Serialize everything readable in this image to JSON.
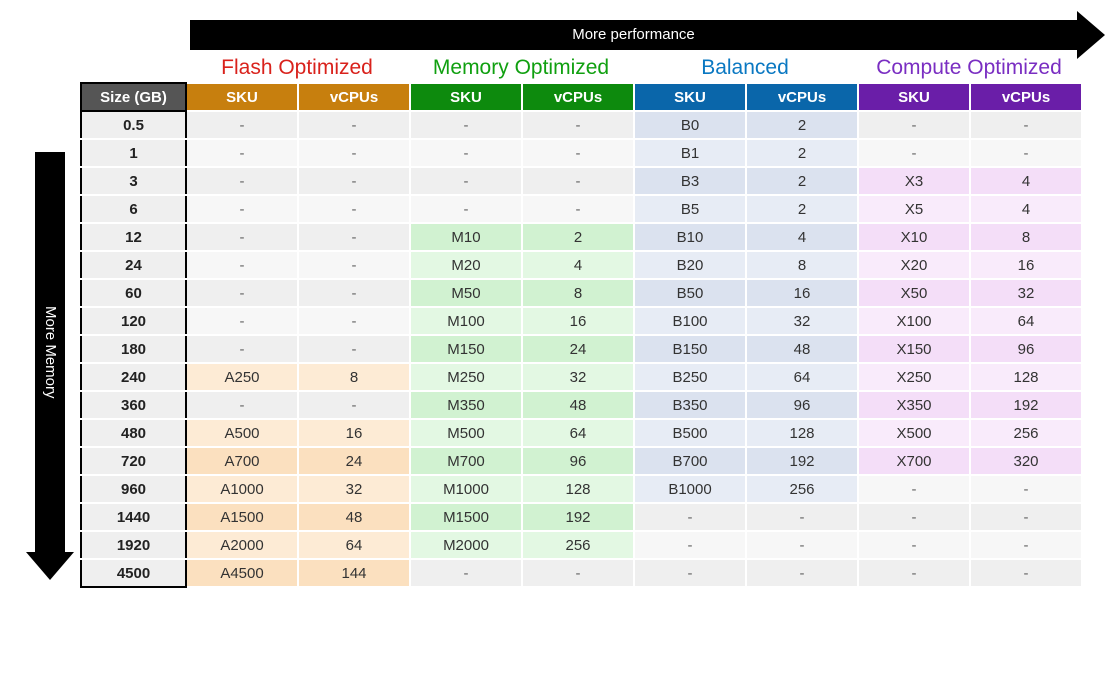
{
  "labels": {
    "more_performance": "More performance",
    "more_memory": "More Memory"
  },
  "categories": {
    "flash": {
      "title": "Flash Optimized",
      "sku": "SKU",
      "vcpu": "vCPUs",
      "color": "#d9221c"
    },
    "memory": {
      "title": "Memory Optimized",
      "sku": "SKU",
      "vcpu": "vCPUs",
      "color": "#10a010"
    },
    "balanced": {
      "title": "Balanced",
      "sku": "SKU",
      "vcpu": "vCPUs",
      "color": "#0a78c2"
    },
    "compute": {
      "title": "Compute Optimized",
      "sku": "SKU",
      "vcpu": "vCPUs",
      "color": "#7a2ec2"
    }
  },
  "size_header": "Size (GB)",
  "chart_data": {
    "type": "table",
    "rows": [
      {
        "size": "0.5",
        "flash": {
          "sku": "-",
          "vcpu": "-"
        },
        "memory": {
          "sku": "-",
          "vcpu": "-"
        },
        "balanced": {
          "sku": "B0",
          "vcpu": "2"
        },
        "compute": {
          "sku": "-",
          "vcpu": "-"
        }
      },
      {
        "size": "1",
        "flash": {
          "sku": "-",
          "vcpu": "-"
        },
        "memory": {
          "sku": "-",
          "vcpu": "-"
        },
        "balanced": {
          "sku": "B1",
          "vcpu": "2"
        },
        "compute": {
          "sku": "-",
          "vcpu": "-"
        }
      },
      {
        "size": "3",
        "flash": {
          "sku": "-",
          "vcpu": "-"
        },
        "memory": {
          "sku": "-",
          "vcpu": "-"
        },
        "balanced": {
          "sku": "B3",
          "vcpu": "2"
        },
        "compute": {
          "sku": "X3",
          "vcpu": "4"
        }
      },
      {
        "size": "6",
        "flash": {
          "sku": "-",
          "vcpu": "-"
        },
        "memory": {
          "sku": "-",
          "vcpu": "-"
        },
        "balanced": {
          "sku": "B5",
          "vcpu": "2"
        },
        "compute": {
          "sku": "X5",
          "vcpu": "4"
        }
      },
      {
        "size": "12",
        "flash": {
          "sku": "-",
          "vcpu": "-"
        },
        "memory": {
          "sku": "M10",
          "vcpu": "2"
        },
        "balanced": {
          "sku": "B10",
          "vcpu": "4"
        },
        "compute": {
          "sku": "X10",
          "vcpu": "8"
        }
      },
      {
        "size": "24",
        "flash": {
          "sku": "-",
          "vcpu": "-"
        },
        "memory": {
          "sku": "M20",
          "vcpu": "4"
        },
        "balanced": {
          "sku": "B20",
          "vcpu": "8"
        },
        "compute": {
          "sku": "X20",
          "vcpu": "16"
        }
      },
      {
        "size": "60",
        "flash": {
          "sku": "-",
          "vcpu": "-"
        },
        "memory": {
          "sku": "M50",
          "vcpu": "8"
        },
        "balanced": {
          "sku": "B50",
          "vcpu": "16"
        },
        "compute": {
          "sku": "X50",
          "vcpu": "32"
        }
      },
      {
        "size": "120",
        "flash": {
          "sku": "-",
          "vcpu": "-"
        },
        "memory": {
          "sku": "M100",
          "vcpu": "16"
        },
        "balanced": {
          "sku": "B100",
          "vcpu": "32"
        },
        "compute": {
          "sku": "X100",
          "vcpu": "64"
        }
      },
      {
        "size": "180",
        "flash": {
          "sku": "-",
          "vcpu": "-"
        },
        "memory": {
          "sku": "M150",
          "vcpu": "24"
        },
        "balanced": {
          "sku": "B150",
          "vcpu": "48"
        },
        "compute": {
          "sku": "X150",
          "vcpu": "96"
        }
      },
      {
        "size": "240",
        "flash": {
          "sku": "A250",
          "vcpu": "8"
        },
        "memory": {
          "sku": "M250",
          "vcpu": "32"
        },
        "balanced": {
          "sku": "B250",
          "vcpu": "64"
        },
        "compute": {
          "sku": "X250",
          "vcpu": "128"
        }
      },
      {
        "size": "360",
        "flash": {
          "sku": "-",
          "vcpu": "-"
        },
        "memory": {
          "sku": "M350",
          "vcpu": "48"
        },
        "balanced": {
          "sku": "B350",
          "vcpu": "96"
        },
        "compute": {
          "sku": "X350",
          "vcpu": "192"
        }
      },
      {
        "size": "480",
        "flash": {
          "sku": "A500",
          "vcpu": "16"
        },
        "memory": {
          "sku": "M500",
          "vcpu": "64"
        },
        "balanced": {
          "sku": "B500",
          "vcpu": "128"
        },
        "compute": {
          "sku": "X500",
          "vcpu": "256"
        }
      },
      {
        "size": "720",
        "flash": {
          "sku": "A700",
          "vcpu": "24"
        },
        "memory": {
          "sku": "M700",
          "vcpu": "96"
        },
        "balanced": {
          "sku": "B700",
          "vcpu": "192"
        },
        "compute": {
          "sku": "X700",
          "vcpu": "320"
        }
      },
      {
        "size": "960",
        "flash": {
          "sku": "A1000",
          "vcpu": "32"
        },
        "memory": {
          "sku": "M1000",
          "vcpu": "128"
        },
        "balanced": {
          "sku": "B1000",
          "vcpu": "256"
        },
        "compute": {
          "sku": "-",
          "vcpu": "-"
        }
      },
      {
        "size": "1440",
        "flash": {
          "sku": "A1500",
          "vcpu": "48"
        },
        "memory": {
          "sku": "M1500",
          "vcpu": "192"
        },
        "balanced": {
          "sku": "-",
          "vcpu": "-"
        },
        "compute": {
          "sku": "-",
          "vcpu": "-"
        }
      },
      {
        "size": "1920",
        "flash": {
          "sku": "A2000",
          "vcpu": "64"
        },
        "memory": {
          "sku": "M2000",
          "vcpu": "256"
        },
        "balanced": {
          "sku": "-",
          "vcpu": "-"
        },
        "compute": {
          "sku": "-",
          "vcpu": "-"
        }
      },
      {
        "size": "4500",
        "flash": {
          "sku": "A4500",
          "vcpu": "144"
        },
        "memory": {
          "sku": "-",
          "vcpu": "-"
        },
        "balanced": {
          "sku": "-",
          "vcpu": "-"
        },
        "compute": {
          "sku": "-",
          "vcpu": "-"
        }
      }
    ]
  }
}
